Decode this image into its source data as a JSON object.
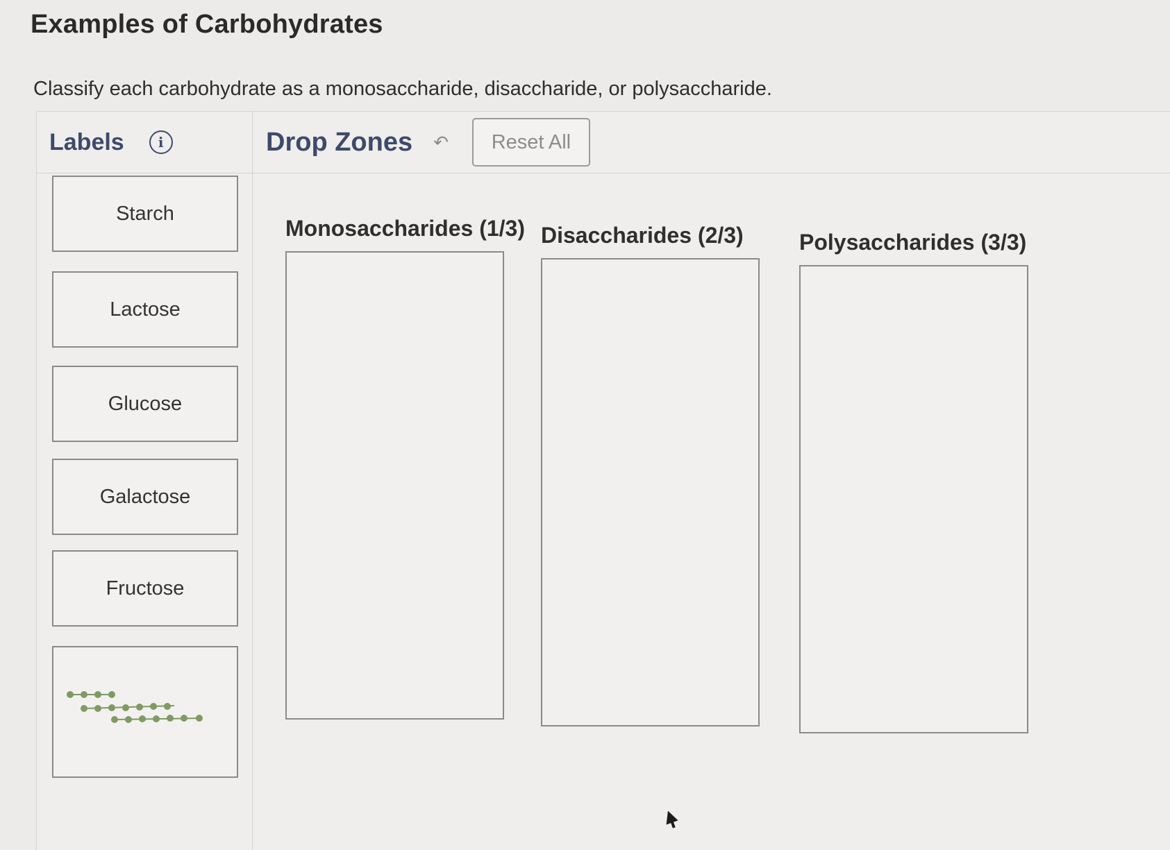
{
  "page": {
    "title": "Examples of Carbohydrates",
    "instructions": "Classify each carbohydrate as a monosaccharide, disaccharide, or polysaccharide."
  },
  "labels_panel": {
    "header": "Labels",
    "info_icon": "info-icon",
    "items": [
      {
        "label": "Starch"
      },
      {
        "label": "Lactose"
      },
      {
        "label": "Glucose"
      },
      {
        "label": "Galactose"
      },
      {
        "label": "Fructose"
      },
      {
        "label": "",
        "image": "glucose-chain-icon"
      }
    ]
  },
  "drop_panel": {
    "header": "Drop Zones",
    "undo_icon": "undo-arrow-icon",
    "reset_label": "Reset All",
    "zones": [
      {
        "title": "Monosaccharides (1/3)"
      },
      {
        "title": "Disaccharides (2/3)"
      },
      {
        "title": "Polysaccharides (3/3)"
      }
    ]
  },
  "colors": {
    "header_text": "#3d4a6b",
    "chain_bead": "#7f9a63"
  }
}
